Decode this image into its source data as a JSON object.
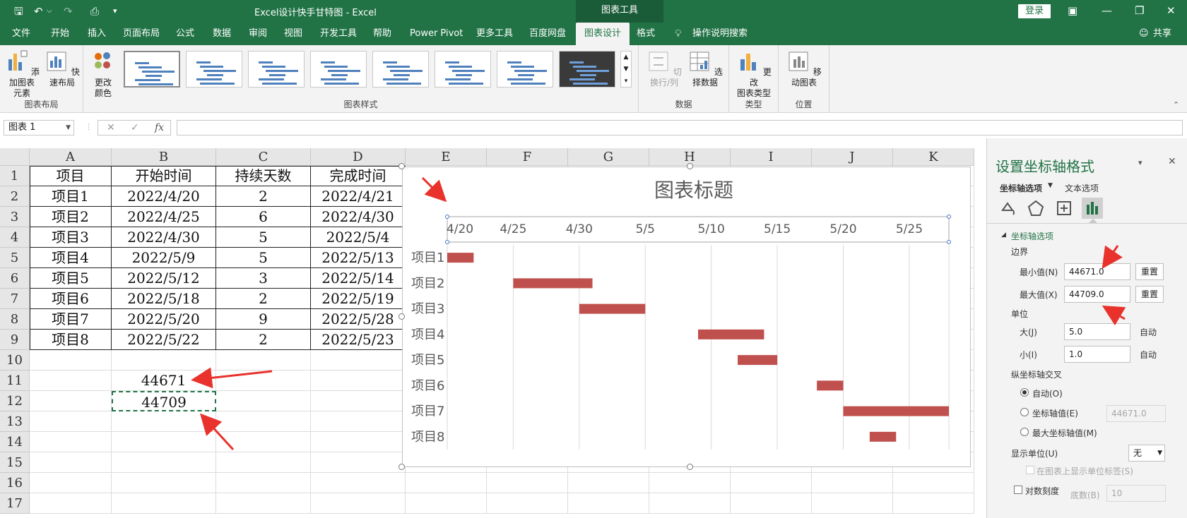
{
  "window": {
    "title": "Excel设计快手甘特图  -  Excel",
    "context_tab": "图表工具",
    "login_label": "登录"
  },
  "tabs": [
    "文件",
    "开始",
    "插入",
    "页面布局",
    "公式",
    "数据",
    "审阅",
    "视图",
    "开发工具",
    "帮助",
    "Power Pivot",
    "更多工具",
    "百度网盘",
    "图表设计",
    "格式"
  ],
  "active_tab": "图表设计",
  "tell_me": "操作说明搜索",
  "share": "共享",
  "ribbon": {
    "add_element": "添加图表\n元素",
    "quick_layout": "快速布局",
    "change_color": "更改\n颜色",
    "group_layout": "图表布局",
    "group_styles": "图表样式",
    "switch_row_col": "切换行/列",
    "select_data": "选择数据",
    "group_data": "数据",
    "change_type": "更改\n图表类型",
    "group_type": "类型",
    "move_chart": "移动图表",
    "group_location": "位置"
  },
  "formula_bar": {
    "name_box": "图表 1",
    "fx": "fx",
    "value": ""
  },
  "columns": [
    "A",
    "B",
    "C",
    "D",
    "E",
    "F",
    "G",
    "H",
    "I",
    "J",
    "K"
  ],
  "rows": [
    "1",
    "2",
    "3",
    "4",
    "5",
    "6",
    "7",
    "8",
    "9",
    "10",
    "11",
    "12",
    "13",
    "14",
    "15",
    "16",
    "17"
  ],
  "table": {
    "headers": [
      "项目",
      "开始时间",
      "持续天数",
      "完成时间"
    ],
    "rows": [
      [
        "项目1",
        "2022/4/20",
        "2",
        "2022/4/21"
      ],
      [
        "项目2",
        "2022/4/25",
        "6",
        "2022/4/30"
      ],
      [
        "项目3",
        "2022/4/30",
        "5",
        "2022/5/4"
      ],
      [
        "项目4",
        "2022/5/9",
        "5",
        "2022/5/13"
      ],
      [
        "项目5",
        "2022/5/12",
        "3",
        "2022/5/14"
      ],
      [
        "项目6",
        "2022/5/18",
        "2",
        "2022/5/19"
      ],
      [
        "项目7",
        "2022/5/20",
        "9",
        "2022/5/28"
      ],
      [
        "项目8",
        "2022/5/22",
        "2",
        "2022/5/23"
      ]
    ],
    "b11": "44671",
    "b12": "44709"
  },
  "chart_data": {
    "type": "bar",
    "title": "图表标题",
    "categories": [
      "项目1",
      "项目2",
      "项目3",
      "项目4",
      "项目5",
      "项目6",
      "项目7",
      "项目8"
    ],
    "x_tick_labels": [
      "4/20",
      "4/25",
      "4/30",
      "5/5",
      "5/10",
      "5/15",
      "5/20",
      "5/25"
    ],
    "x_axis_min": 44671,
    "x_axis_max": 44709,
    "x_major_unit": 5,
    "x_axis_position": "top",
    "series": [
      {
        "start": [
          44671,
          44676,
          44681,
          44690,
          44693,
          44699,
          44701,
          44703
        ],
        "duration": [
          2,
          6,
          5,
          5,
          3,
          2,
          9,
          2
        ],
        "color": "#c0504d"
      }
    ],
    "grid": true
  },
  "pane": {
    "title": "设置坐标轴格式",
    "tab_axis": "坐标轴选项",
    "tab_text": "文本选项",
    "section": "坐标轴选项",
    "bounds": "边界",
    "min_label": "最小值(N)",
    "min_value": "44671.0",
    "max_label": "最大值(X)",
    "max_value": "44709.0",
    "reset": "重置",
    "units": "单位",
    "major_label": "大(J)",
    "major_value": "5.0",
    "minor_label": "小(I)",
    "minor_value": "1.0",
    "auto": "自动",
    "cross": "纵坐标轴交叉",
    "radio_auto": "自动(O)",
    "radio_value": "坐标轴值(E)",
    "radio_value_input": "44671.0",
    "radio_max": "最大坐标轴值(M)",
    "display_units": "显示单位(U)",
    "display_units_value": "无",
    "show_unit_label": "在图表上显示单位标签(S)",
    "log_scale": "对数刻度",
    "base_label": "底数(B)",
    "base_value": "10"
  }
}
